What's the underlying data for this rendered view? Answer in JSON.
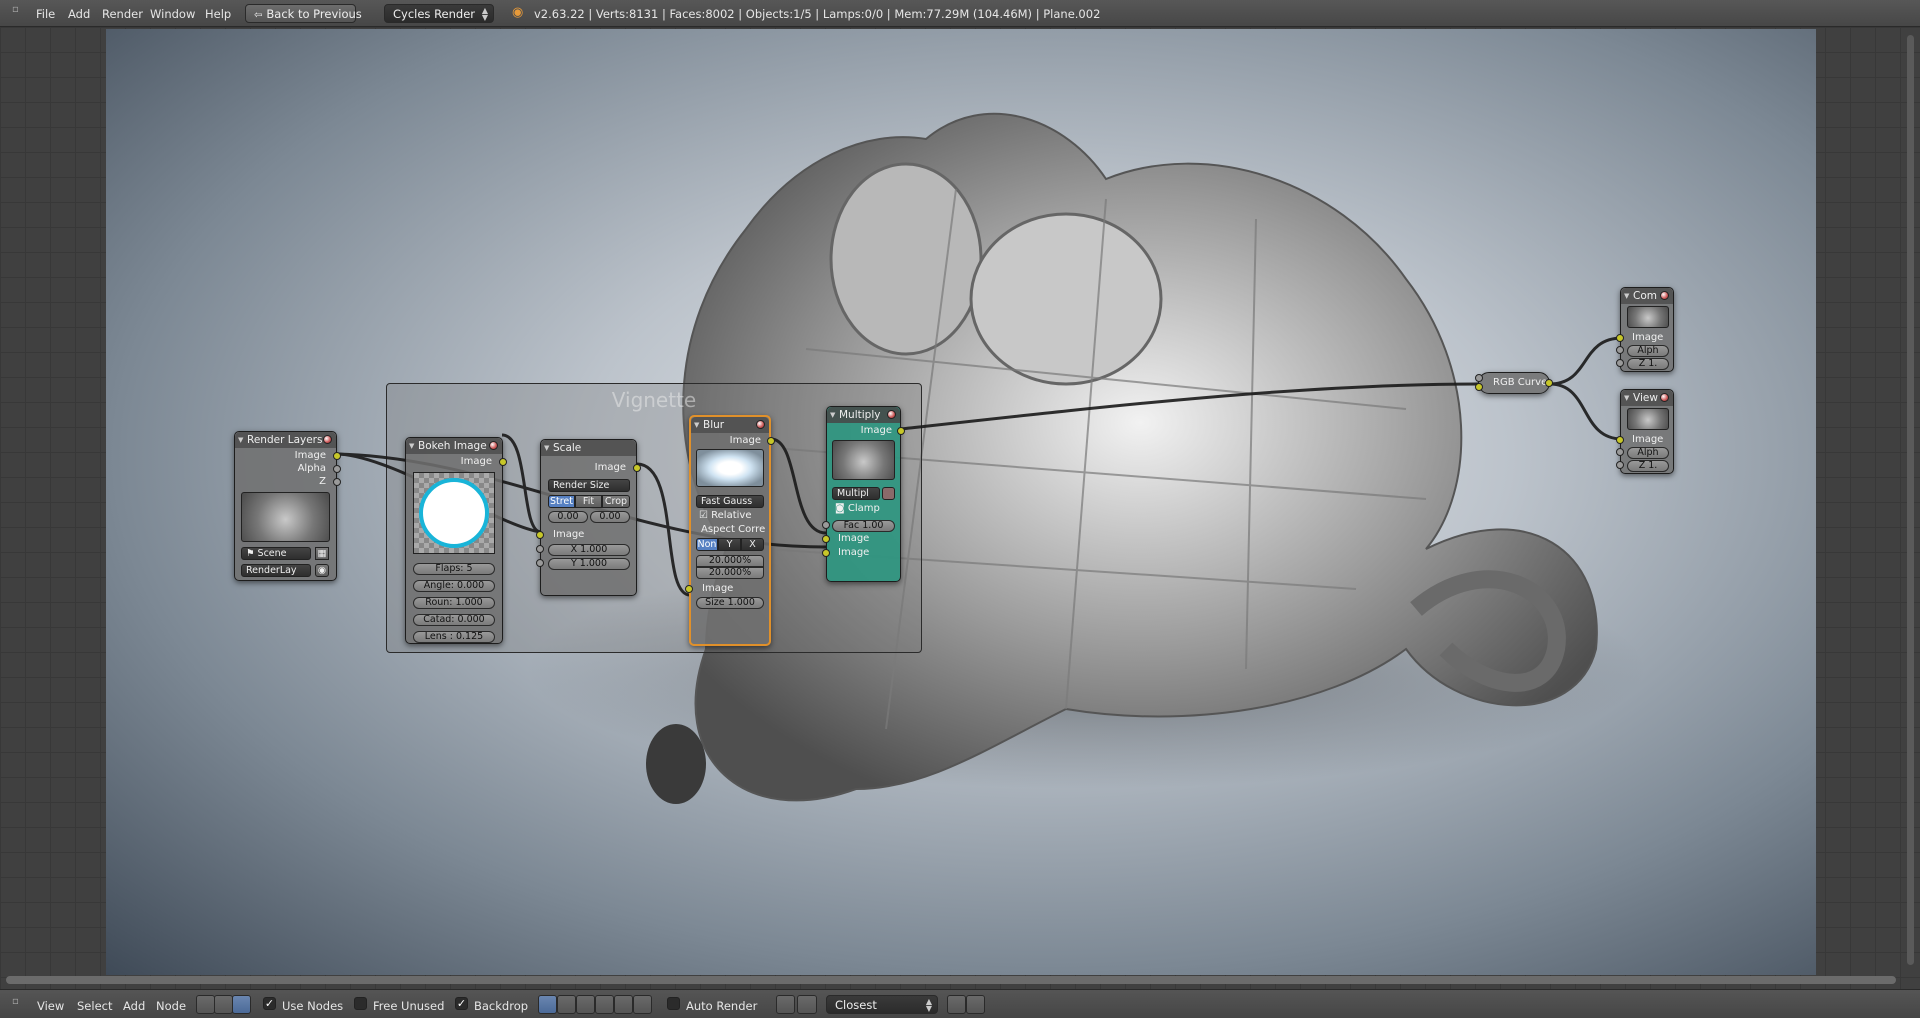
{
  "topbar": {
    "menus": [
      "File",
      "Add",
      "Render",
      "Window",
      "Help"
    ],
    "back_button": "Back to Previous",
    "render_engine": "Cycles Render",
    "stats": "v2.63.22 | Verts:8131 | Faces:8002 | Objects:1/5 | Lamps:0/0 | Mem:77.29M (104.46M) | Plane.002"
  },
  "frame": {
    "label": "Vignette"
  },
  "nodes": {
    "render_layers": {
      "title": "Render Layers",
      "out_image": "Image",
      "out_alpha": "Alpha",
      "out_z": "Z",
      "scene": "Scene",
      "layer": "RenderLay"
    },
    "bokeh_image": {
      "title": "Bokeh Image",
      "out_image": "Image",
      "flaps": "Flaps: 5",
      "angle": "Angle: 0.000",
      "rounding": "Roun: 1.000",
      "catadioptric": "Catad: 0.000",
      "lens_shift": "Lens : 0.125"
    },
    "scale": {
      "title": "Scale",
      "out_image": "Image",
      "space": "Render Size",
      "modes": [
        "Stret",
        "Fit",
        "Crop"
      ],
      "offset_x": "0.00",
      "offset_y": "0.00",
      "in_image": "Image",
      "x": "X 1.000",
      "y": "Y 1.000"
    },
    "blur": {
      "title": "Blur",
      "out_image": "Image",
      "filter": "Fast Gauss",
      "relative": "Relative",
      "aspect_label": "Aspect Corre",
      "aspect_modes": [
        "Non",
        "Y",
        "X"
      ],
      "size_x": "20.000%",
      "size_y": "20.000%",
      "in_image": "Image",
      "size": "Size 1.000"
    },
    "multiply": {
      "title": "Multiply",
      "out_image": "Image",
      "blend": "Multipl",
      "clamp": "Clamp",
      "fac": "Fac 1.00",
      "in_image1": "Image",
      "in_image2": "Image"
    },
    "rgb_curve": {
      "title": "RGB Curve"
    },
    "composite": {
      "title": "Com",
      "in_image": "Image",
      "alpha": "Alph",
      "z": "Z 1."
    },
    "viewer": {
      "title": "View",
      "in_image": "Image",
      "alpha": "Alph",
      "z": "Z 1."
    }
  },
  "bottombar": {
    "menus": [
      "View",
      "Select",
      "Add",
      "Node"
    ],
    "use_nodes": "Use Nodes",
    "free_unused": "Free Unused",
    "backdrop": "Backdrop",
    "auto_render": "Auto Render",
    "interpolation": "Closest"
  }
}
